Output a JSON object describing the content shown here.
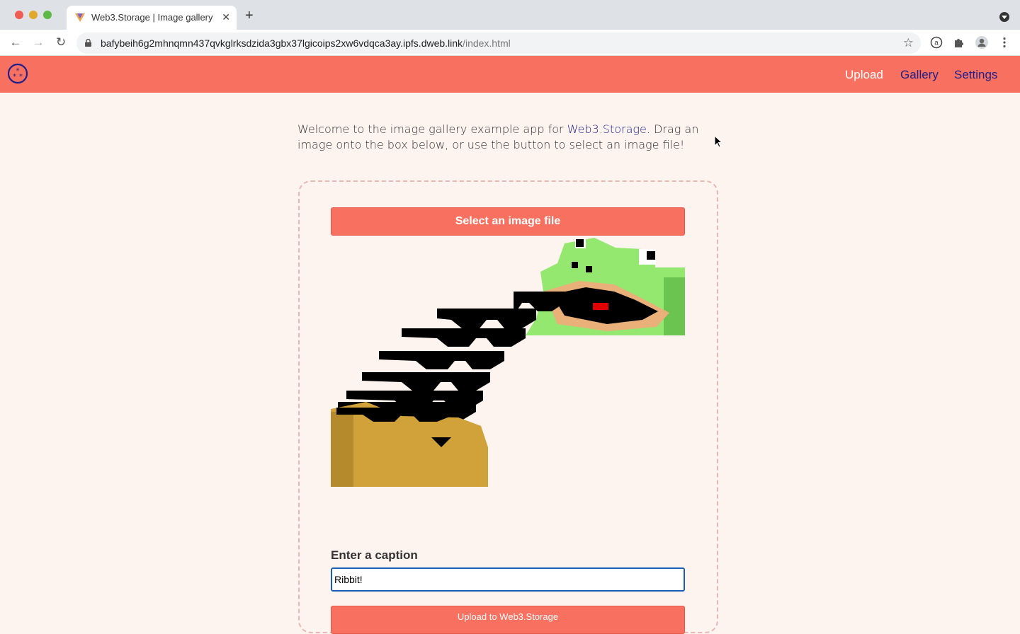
{
  "browser": {
    "tab_title": "Web3.Storage | Image gallery e",
    "url_host": "bafybeih6g2mhnqmn437qvkglrksdzida3gbx37lgicoips2xw6vdqca3ay.ipfs.dweb.link",
    "url_path": "/index.html"
  },
  "nav": {
    "upload": "Upload",
    "gallery": "Gallery",
    "settings": "Settings"
  },
  "intro": {
    "before_link": "Welcome to the image gallery example app for ",
    "link": "Web3.Storage",
    "after_link": ". Drag an image onto the box below, or use the button to select an image file!"
  },
  "upload_form": {
    "select_button": "Select an image file",
    "caption_label": "Enter a caption",
    "caption_value": "Ribbit!",
    "upload_button": "Upload to Web3.Storage"
  },
  "colors": {
    "header": "#f87060",
    "accent": "#f87060",
    "link": "#1e1f8a",
    "background": "#fdf3ef"
  }
}
